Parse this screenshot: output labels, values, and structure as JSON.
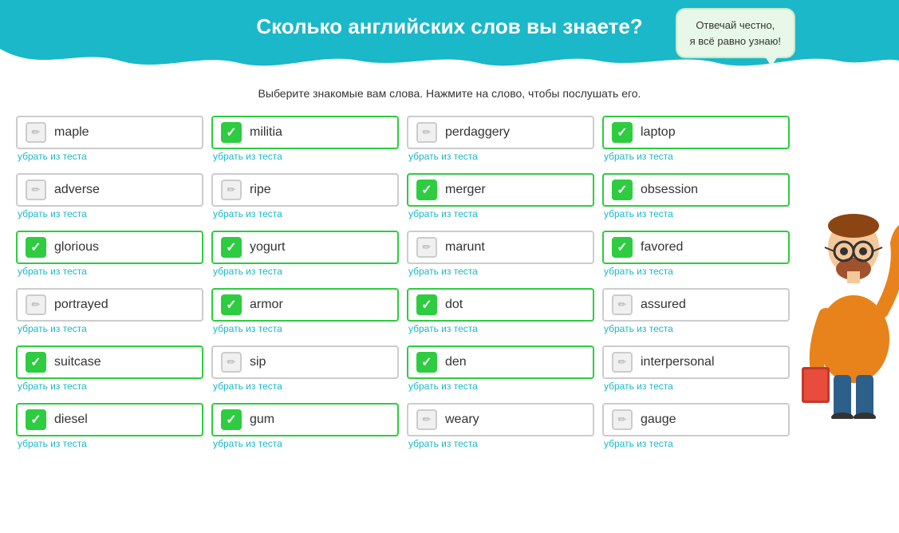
{
  "header": {
    "title": "Сколько английских слов вы знаете?",
    "bubble_line1": "Отвечай честно,",
    "bubble_line2": "я всё равно узнаю!"
  },
  "subtitle": "Выберите знакомые вам слова. Нажмите на слово, чтобы послушать его.",
  "remove_label": "убрать из теста",
  "words": [
    {
      "word": "maple",
      "selected": false,
      "col": 0,
      "row": 0
    },
    {
      "word": "militia",
      "selected": true,
      "col": 1,
      "row": 0
    },
    {
      "word": "perdaggery",
      "selected": false,
      "col": 2,
      "row": 0
    },
    {
      "word": "laptop",
      "selected": true,
      "col": 3,
      "row": 0
    },
    {
      "word": "adverse",
      "selected": false,
      "col": 0,
      "row": 1
    },
    {
      "word": "ripe",
      "selected": false,
      "col": 1,
      "row": 1
    },
    {
      "word": "merger",
      "selected": true,
      "col": 2,
      "row": 1
    },
    {
      "word": "obsession",
      "selected": true,
      "col": 3,
      "row": 1
    },
    {
      "word": "glorious",
      "selected": true,
      "col": 0,
      "row": 2
    },
    {
      "word": "yogurt",
      "selected": true,
      "col": 1,
      "row": 2
    },
    {
      "word": "marunt",
      "selected": false,
      "col": 2,
      "row": 2
    },
    {
      "word": "favored",
      "selected": true,
      "col": 3,
      "row": 2
    },
    {
      "word": "portrayed",
      "selected": false,
      "col": 0,
      "row": 3
    },
    {
      "word": "armor",
      "selected": true,
      "col": 1,
      "row": 3
    },
    {
      "word": "dot",
      "selected": true,
      "col": 2,
      "row": 3
    },
    {
      "word": "assured",
      "selected": false,
      "col": 3,
      "row": 3
    },
    {
      "word": "suitcase",
      "selected": true,
      "col": 0,
      "row": 4
    },
    {
      "word": "sip",
      "selected": false,
      "col": 1,
      "row": 4
    },
    {
      "word": "den",
      "selected": true,
      "col": 2,
      "row": 4
    },
    {
      "word": "interpersonal",
      "selected": false,
      "col": 3,
      "row": 4
    },
    {
      "word": "diesel",
      "selected": true,
      "col": 0,
      "row": 5
    },
    {
      "word": "gum",
      "selected": true,
      "col": 1,
      "row": 5
    },
    {
      "word": "weary",
      "selected": false,
      "col": 2,
      "row": 5
    },
    {
      "word": "gauge",
      "selected": false,
      "col": 3,
      "row": 5
    }
  ]
}
